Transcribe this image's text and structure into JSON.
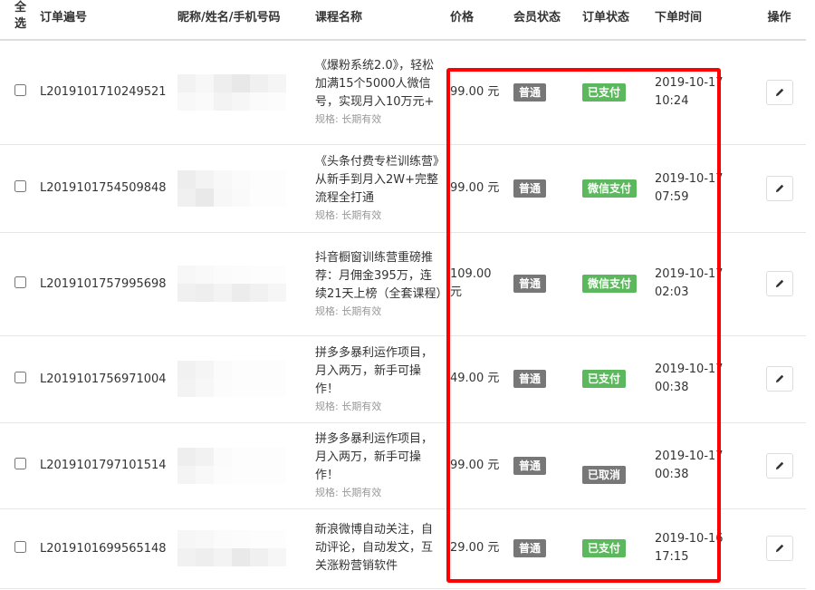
{
  "columns": {
    "select_all": "全选",
    "order_no": "订单遍号",
    "user": "昵称/姓名/手机号码",
    "course": "课程名称",
    "price": "价格",
    "member_status": "会员状态",
    "order_status": "订单状态",
    "order_time": "下单时间",
    "action": "操作"
  },
  "colors": {
    "paid": "#5cb85c",
    "member": "#777777",
    "cancelled": "#777777",
    "highlight": "#ff0000"
  },
  "rows": [
    {
      "order_no": "L2019101710249521",
      "course_title": "《爆粉系统2.0》，轻松加满15个5000人微信号，实现月入10万元+",
      "spec": "规格: 长期有效",
      "price": "99.00 元",
      "member": "普通",
      "status": "已支付",
      "status_style": "green",
      "time": "2019-10-17 10:24"
    },
    {
      "order_no": "L2019101754509848",
      "course_title": "《头条付费专栏训练营》从新手到月入2W+完整流程全打通",
      "spec": "规格: 长期有效",
      "price": "99.00 元",
      "member": "普通",
      "status": "微信支付",
      "status_style": "green",
      "time": "2019-10-17 07:59"
    },
    {
      "order_no": "L2019101757995698",
      "course_title": "抖音橱窗训练营重磅推荐：月佣金395万，连续21天上榜（全套课程）",
      "spec": "规格: 长期有效",
      "price": "109.00 元",
      "member": "普通",
      "status": "微信支付",
      "status_style": "green",
      "time": "2019-10-17 02:03"
    },
    {
      "order_no": "L2019101756971004",
      "course_title": "拼多多暴利运作项目，月入两万，新手可操作！",
      "spec": "规格: 长期有效",
      "price": "49.00 元",
      "member": "普通",
      "status": "已支付",
      "status_style": "green",
      "time": "2019-10-17 00:38"
    },
    {
      "order_no": "L2019101797101514",
      "course_title": "拼多多暴利运作项目，月入两万，新手可操作！",
      "spec": "规格: 长期有效",
      "price": "99.00 元",
      "member": "普通",
      "status": "已取消",
      "status_style": "dark",
      "time": "2019-10-17 00:38"
    },
    {
      "order_no": "L2019101699565148",
      "course_title": "新浪微博自动关注，自动评论，自动发文，互关涨粉营销软件",
      "spec": "",
      "price": "29.00 元",
      "member": "普通",
      "status": "已支付",
      "status_style": "green",
      "time": "2019-10-16 17:15"
    }
  ]
}
